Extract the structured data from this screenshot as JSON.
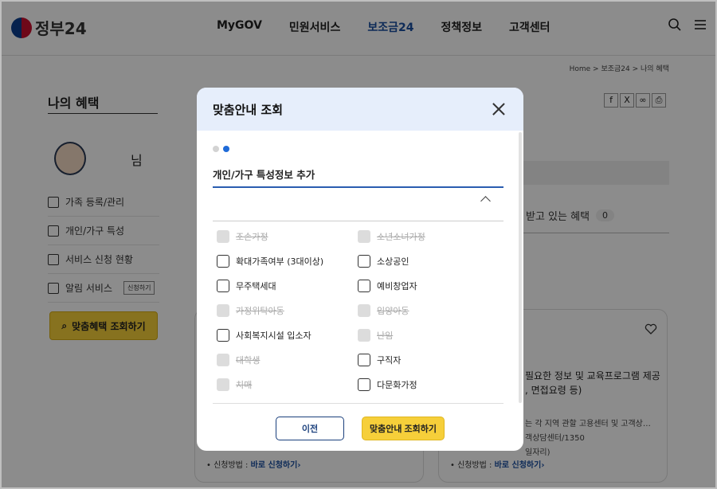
{
  "header": {
    "logo_text": "정부24",
    "nav": [
      {
        "label": "MyGOV",
        "active": false
      },
      {
        "label": "민원서비스",
        "active": false
      },
      {
        "label": "보조금24",
        "active": true
      },
      {
        "label": "정책정보",
        "active": false
      },
      {
        "label": "고객센터",
        "active": false
      }
    ],
    "icons": [
      "search-icon",
      "menu-icon"
    ]
  },
  "breadcrumb": "Home  >  보조금24  >  나의 혜택",
  "page": {
    "title": "나의 혜택",
    "user_suffix": "님",
    "side_menu": [
      {
        "label": "가족 등록/관리",
        "icon": "pencil-icon"
      },
      {
        "label": "개인/가구 특성",
        "icon": "house-icon"
      },
      {
        "label": "서비스 신청 현황",
        "icon": "clipboard-icon"
      },
      {
        "label": "알림 서비스",
        "icon": "bell-icon",
        "pill": "신청하기"
      }
    ],
    "cta_label": "맞춤혜택 조회하기",
    "received_label": "받고 있는 혜택",
    "received_count": "0",
    "card_right_text_1": "필요한 정보 및 교육프로그램 제공",
    "card_right_text_2": ", 면접요령 등)",
    "card_right_text_3": "는 각 지역 관할 고용센터 및 고객상…",
    "card_right_text_4": "객상담센터/1350",
    "card_right_text_5": "일자리)",
    "apply_label": "신청방법 :",
    "apply_link": "바로 신청하기"
  },
  "modal": {
    "title": "맞춤안내 조회",
    "section_title": "개인/가구 특성정보 추가",
    "options": [
      {
        "label": "조손가정",
        "enabled": false
      },
      {
        "label": "소년소녀가정",
        "enabled": false
      },
      {
        "label": "확대가족여부 (3대이상)",
        "enabled": true
      },
      {
        "label": "소상공인",
        "enabled": true
      },
      {
        "label": "무주택세대",
        "enabled": true
      },
      {
        "label": "예비창업자",
        "enabled": true
      },
      {
        "label": "가정위탁아동",
        "enabled": false
      },
      {
        "label": "입양아동",
        "enabled": false
      },
      {
        "label": "사회복지시설 입소자",
        "enabled": true
      },
      {
        "label": "난임",
        "enabled": false
      },
      {
        "label": "대학생",
        "enabled": false
      },
      {
        "label": "구직자",
        "enabled": true
      },
      {
        "label": "치매",
        "enabled": false
      },
      {
        "label": "다문화가정",
        "enabled": true
      }
    ],
    "prev_label": "이전",
    "submit_label": "맞춤안내 조회하기"
  }
}
